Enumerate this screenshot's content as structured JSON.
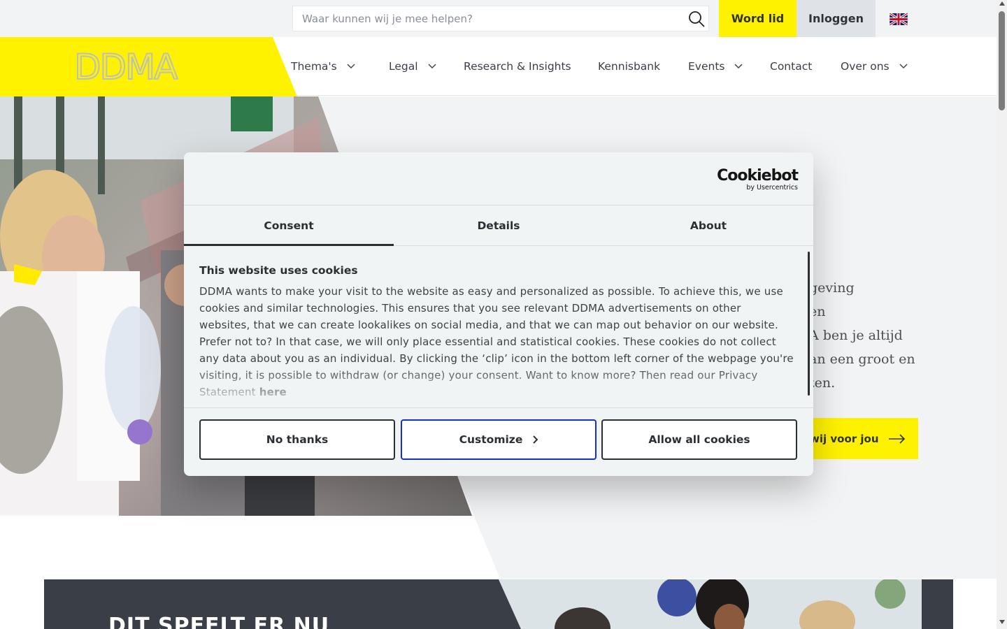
{
  "topbar": {
    "search_placeholder": "Waar kunnen wij je mee helpen?",
    "join_label": "Word lid",
    "login_label": "Inloggen",
    "language_icon": "uk-flag-icon"
  },
  "logo": {
    "text": "DDMA"
  },
  "nav": {
    "items": [
      {
        "label": "Thema's",
        "has_dropdown": true
      },
      {
        "label": "Legal",
        "has_dropdown": true
      },
      {
        "label": "Research & Insights",
        "has_dropdown": false
      },
      {
        "label": "Kennisbank",
        "has_dropdown": false
      },
      {
        "label": "Events",
        "has_dropdown": true
      },
      {
        "label": "Contact",
        "has_dropdown": false
      },
      {
        "label": "Over ons",
        "has_dropdown": true
      }
    ]
  },
  "hero": {
    "text_lines": [
      "geving",
      "en",
      "A ben je altijd",
      "an een groot en",
      "ten."
    ],
    "cta_label": "wij voor jou"
  },
  "bottom": {
    "title": "DIT SPEELT ER NU"
  },
  "cookie_dialog": {
    "brand": "Cookiebot",
    "brand_sub": "by Usercentrics",
    "tabs": [
      "Consent",
      "Details",
      "About"
    ],
    "active_tab": "Consent",
    "heading": "This website uses cookies",
    "body": "DDMA wants to make your visit to the website as easy and personalized as possible. To achieve this, we use cookies and similar technologies. This ensures that you see relevant DDMA advertisements on other websites, that we can create lookalikes on social media, and that we can map out behavior on our website. Prefer not to? In that case, we will only place essential and statistical cookies. These cookies do not collect any data about you as an individual. By clicking the ‘clip’ icon in the bottom left corner of the webpage you're visiting, it is possible to withdraw (or change) your consent. Want to know more? Then read our Privacy Statement ",
    "body_link": "here",
    "buttons": {
      "decline": "No thanks",
      "customize": "Customize",
      "accept": "Allow all cookies"
    },
    "colors": {
      "customize_border": "#1032cf",
      "text": "#2b2f33"
    }
  },
  "colors": {
    "brand_yellow": "#fff200",
    "dark": "#3a3f47",
    "light_gray": "#f2f3f4"
  }
}
